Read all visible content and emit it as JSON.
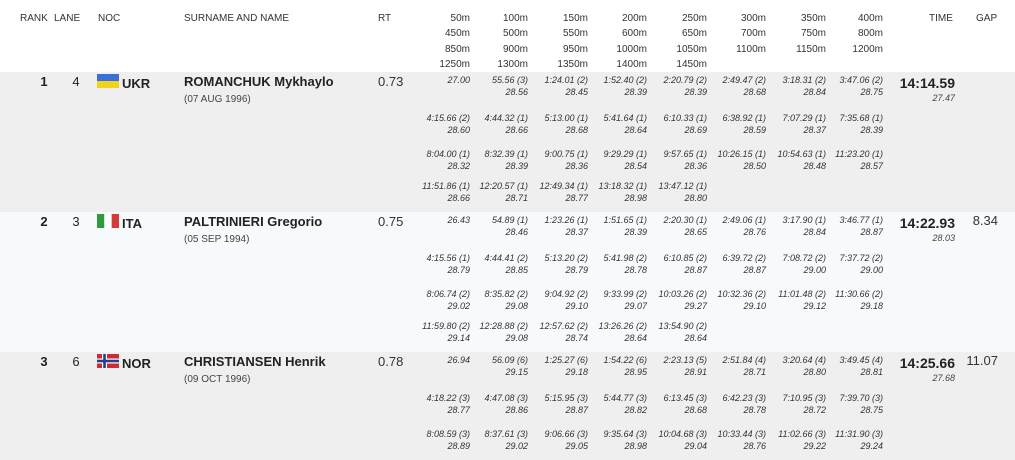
{
  "header": {
    "rank": "RANK",
    "lane": "LANE",
    "noc": "NOC",
    "name": "SURNAME AND NAME",
    "rt": "RT",
    "time": "TIME",
    "gap": "GAP",
    "splits": [
      [
        "50m",
        "450m",
        "850m",
        "1250m"
      ],
      [
        "100m",
        "500m",
        "900m",
        "1300m"
      ],
      [
        "150m",
        "550m",
        "950m",
        "1350m"
      ],
      [
        "200m",
        "600m",
        "1000m",
        "1400m"
      ],
      [
        "250m",
        "650m",
        "1050m",
        "1450m"
      ],
      [
        "300m",
        "700m",
        "1100m"
      ],
      [
        "350m",
        "750m",
        "1150m"
      ],
      [
        "400m",
        "800m",
        "1200m"
      ]
    ]
  },
  "athletes": [
    {
      "rank": "1",
      "lane": "4",
      "noc": "UKR",
      "flag": "ukraine-flag",
      "name": "ROMANCHUK Mykhaylo",
      "dob": "(07 AUG 1996)",
      "rt": "0.73",
      "time": "14:14.59",
      "last_lap": "27.47",
      "gap": "",
      "splits": [
        [
          [
            "27.00",
            ""
          ],
          [
            "55.56 (3)",
            "28.56"
          ],
          [
            "1:24.01 (2)",
            "28.45"
          ],
          [
            "1:52.40 (2)",
            "28.39"
          ],
          [
            "2:20.79 (2)",
            "28.39"
          ],
          [
            "2:49.47 (2)",
            "28.68"
          ],
          [
            "3:18.31 (2)",
            "28.84"
          ],
          [
            "3:47.06 (2)",
            "28.75"
          ]
        ],
        [
          [
            "4:15.66 (2)",
            "28.60"
          ],
          [
            "4:44.32 (1)",
            "28.66"
          ],
          [
            "5:13.00 (1)",
            "28.68"
          ],
          [
            "5:41.64 (1)",
            "28.64"
          ],
          [
            "6:10.33 (1)",
            "28.69"
          ],
          [
            "6:38.92 (1)",
            "28.59"
          ],
          [
            "7:07.29 (1)",
            "28.37"
          ],
          [
            "7:35.68 (1)",
            "28.39"
          ]
        ],
        [
          [
            "8:04.00 (1)",
            "28.32"
          ],
          [
            "8:32.39 (1)",
            "28.39"
          ],
          [
            "9:00.75 (1)",
            "28.36"
          ],
          [
            "9:29.29 (1)",
            "28.54"
          ],
          [
            "9:57.65 (1)",
            "28.36"
          ],
          [
            "10:26.15 (1)",
            "28.50"
          ],
          [
            "10:54.63 (1)",
            "28.48"
          ],
          [
            "11:23.20 (1)",
            "28.57"
          ]
        ],
        [
          [
            "11:51.86 (1)",
            "28.66"
          ],
          [
            "12:20.57 (1)",
            "28.71"
          ],
          [
            "12:49.34 (1)",
            "28.77"
          ],
          [
            "13:18.32 (1)",
            "28.98"
          ],
          [
            "13:47.12 (1)",
            "28.80"
          ]
        ]
      ]
    },
    {
      "rank": "2",
      "lane": "3",
      "noc": "ITA",
      "flag": "italy-flag",
      "name": "PALTRINIERI Gregorio",
      "dob": "(05 SEP 1994)",
      "rt": "0.75",
      "time": "14:22.93",
      "last_lap": "28.03",
      "gap": "8.34",
      "splits": [
        [
          [
            "26.43",
            ""
          ],
          [
            "54.89 (1)",
            "28.46"
          ],
          [
            "1:23.26 (1)",
            "28.37"
          ],
          [
            "1:51.65 (1)",
            "28.39"
          ],
          [
            "2:20.30 (1)",
            "28.65"
          ],
          [
            "2:49.06 (1)",
            "28.76"
          ],
          [
            "3:17.90 (1)",
            "28.84"
          ],
          [
            "3:46.77 (1)",
            "28.87"
          ]
        ],
        [
          [
            "4:15.56 (1)",
            "28.79"
          ],
          [
            "4:44.41 (2)",
            "28.85"
          ],
          [
            "5:13.20 (2)",
            "28.79"
          ],
          [
            "5:41.98 (2)",
            "28.78"
          ],
          [
            "6:10.85 (2)",
            "28.87"
          ],
          [
            "6:39.72 (2)",
            "28.87"
          ],
          [
            "7:08.72 (2)",
            "29.00"
          ],
          [
            "7:37.72 (2)",
            "29.00"
          ]
        ],
        [
          [
            "8:06.74 (2)",
            "29.02"
          ],
          [
            "8:35.82 (2)",
            "29.08"
          ],
          [
            "9:04.92 (2)",
            "29.10"
          ],
          [
            "9:33.99 (2)",
            "29.07"
          ],
          [
            "10:03.26 (2)",
            "29.27"
          ],
          [
            "10:32.36 (2)",
            "29.10"
          ],
          [
            "11:01.48 (2)",
            "29.12"
          ],
          [
            "11:30.66 (2)",
            "29.18"
          ]
        ],
        [
          [
            "11:59.80 (2)",
            "29.14"
          ],
          [
            "12:28.88 (2)",
            "29.08"
          ],
          [
            "12:57.62 (2)",
            "28.74"
          ],
          [
            "13:26.26 (2)",
            "28.64"
          ],
          [
            "13:54.90 (2)",
            "28.64"
          ]
        ]
      ]
    },
    {
      "rank": "3",
      "lane": "6",
      "noc": "NOR",
      "flag": "norway-flag",
      "name": "CHRISTIANSEN Henrik",
      "dob": "(09 OCT 1996)",
      "rt": "0.78",
      "time": "14:25.66",
      "last_lap": "27.68",
      "gap": "11.07",
      "splits": [
        [
          [
            "26.94",
            ""
          ],
          [
            "56.09 (6)",
            "29.15"
          ],
          [
            "1:25.27 (6)",
            "29.18"
          ],
          [
            "1:54.22 (6)",
            "28.95"
          ],
          [
            "2:23.13 (5)",
            "28.91"
          ],
          [
            "2:51.84 (4)",
            "28.71"
          ],
          [
            "3:20.64 (4)",
            "28.80"
          ],
          [
            "3:49.45 (4)",
            "28.81"
          ]
        ],
        [
          [
            "4:18.22 (3)",
            "28.77"
          ],
          [
            "4:47.08 (3)",
            "28.86"
          ],
          [
            "5:15.95 (3)",
            "28.87"
          ],
          [
            "5:44.77 (3)",
            "28.82"
          ],
          [
            "6:13.45 (3)",
            "28.68"
          ],
          [
            "6:42.23 (3)",
            "28.78"
          ],
          [
            "7:10.95 (3)",
            "28.72"
          ],
          [
            "7:39.70 (3)",
            "28.75"
          ]
        ],
        [
          [
            "8:08.59 (3)",
            "28.89"
          ],
          [
            "8:37.61 (3)",
            "29.02"
          ],
          [
            "9:06.66 (3)",
            "29.05"
          ],
          [
            "9:35.64 (3)",
            "28.98"
          ],
          [
            "10:04.68 (3)",
            "29.04"
          ],
          [
            "10:33.44 (3)",
            "28.76"
          ],
          [
            "11:02.66 (3)",
            "29.22"
          ],
          [
            "11:31.90 (3)",
            "29.24"
          ]
        ]
      ]
    }
  ]
}
